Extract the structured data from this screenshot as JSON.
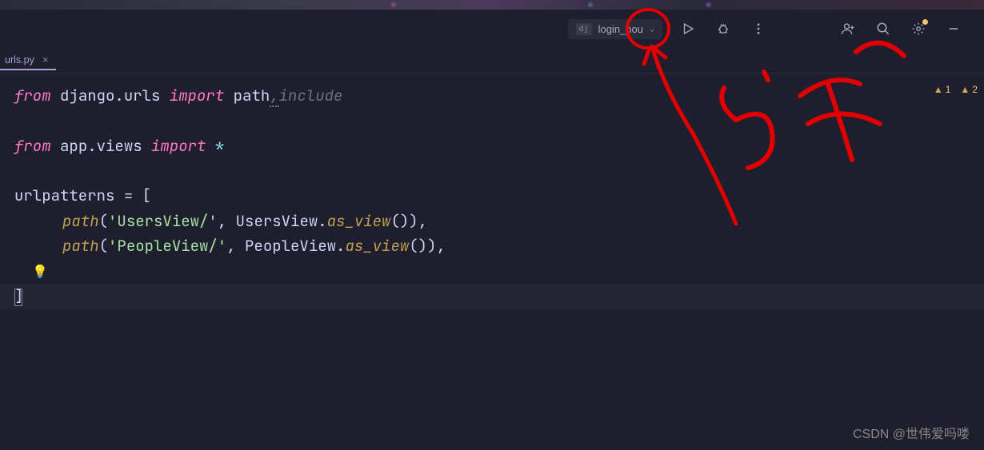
{
  "toolbar": {
    "run_config_badge": "dj",
    "run_config_name": "login_hou"
  },
  "tab": {
    "filename": "urls.py"
  },
  "warnings": {
    "warn1_count": "1",
    "warn2_count": "2"
  },
  "code": {
    "line1": {
      "from": "from",
      "pkg": "django.urls",
      "import": "import",
      "id1": "path",
      "id2": "include"
    },
    "line3": {
      "from": "from",
      "pkg": "app.views",
      "import": "import",
      "star": "*"
    },
    "line5": {
      "id": "urlpatterns",
      "eq": "=",
      "bracket": "["
    },
    "line6": {
      "fn": "path",
      "open": "(",
      "str": "'UsersView/'",
      "comma1": ",",
      "cls": "UsersView",
      "dot": ".",
      "meth": "as_view",
      "call": "())",
      "comma2": ","
    },
    "line7": {
      "fn": "path",
      "open": "(",
      "str": "'PeopleView/'",
      "comma1": ",",
      "cls": "PeopleView",
      "dot": ".",
      "meth": "as_view",
      "call": "())",
      "comma2": ","
    },
    "line9": {
      "bracket": "]"
    }
  },
  "annotation": {
    "text": "运行"
  },
  "watermark": "CSDN @世伟爱吗喽"
}
